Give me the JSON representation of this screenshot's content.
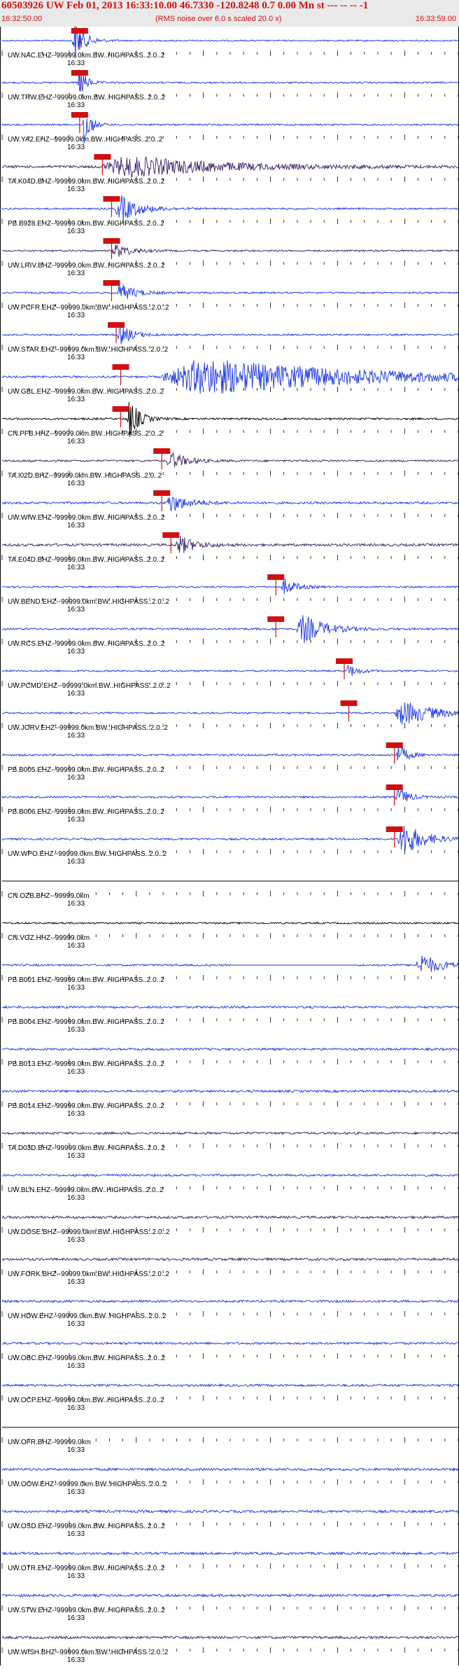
{
  "header": {
    "title": "60503926 UW Feb 01, 2013 16:33:10.00   46.7330 -120.8248  0.7 0.00 Mn st --- -- --  -1",
    "start_time": "16:32:50.00",
    "note": "(RMS noise over 6.0 s scaled 20.0 x)",
    "end_time": "16:33:59.00"
  },
  "colors": {
    "accent": "#d01010",
    "trace_blue": "#1a35e8",
    "trace_black": "#000000",
    "trace_purple": "#3a1e6a"
  },
  "time_tick_label": "16:33",
  "traces": [
    {
      "label": "UW.NAC.EHZ--99999.0km.BW..HIGHPASS..2.0..2",
      "color": "blue",
      "pick": 0.17,
      "event": [
        0.16,
        0.03,
        1.8
      ],
      "noise": 0.25
    },
    {
      "label": "UW.TRW.EHZ--99999.0km.BW..HIGHPASS..2.0..2",
      "color": "blue",
      "pick": 0.17,
      "event": [
        0.17,
        0.02,
        1.5
      ],
      "noise": 0.3
    },
    {
      "label": "UW.YA2.EHZ--99999.0km.BW..HIGHPASS..2.0..2",
      "color": "blue",
      "pick": 0.17,
      "event": [
        0.18,
        0.02,
        2.0
      ],
      "noise": 0.3
    },
    {
      "label": "TA.K04D.BHZ--99999.0km.BW..HIGHPASS..2.0..2",
      "color": "purple",
      "pick": 0.22,
      "event": [
        0.28,
        0.3,
        0.9
      ],
      "noise": 0.45
    },
    {
      "label": "PB.B928.EHZ--99999.0km.BW..HIGHPASS..2.0..2",
      "color": "blue",
      "pick": 0.24,
      "event": [
        0.26,
        0.06,
        1.2
      ],
      "noise": 0.3
    },
    {
      "label": "UW.LRIV.BHZ--99999.0km.BW..HIGHPASS..2.0..2",
      "color": "purple",
      "pick": 0.24,
      "event": [
        0.25,
        0.05,
        0.6
      ],
      "noise": 0.3
    },
    {
      "label": "UW.PCFR.EHZ--99999.0km.BW..HIGHPASS..2.0..2",
      "color": "blue",
      "pick": 0.24,
      "event": [
        0.26,
        0.05,
        0.8
      ],
      "noise": 0.3
    },
    {
      "label": "UW.STAR.EHZ--99999.0km.BW..HIGHPASS..2.0..2",
      "color": "blue",
      "pick": 0.25,
      "event": [
        0.26,
        0.04,
        0.9
      ],
      "noise": 0.3
    },
    {
      "label": "UW.GBL.EHZ--99999.0km.BW..HIGHPASS..2.0..2",
      "color": "blue",
      "pick": 0.26,
      "event": [
        0.45,
        0.5,
        1.6
      ],
      "noise": 0.35
    },
    {
      "label": "CN.PFB.HHZ--99999.0km.BW..HIGHPASS..2.0..2",
      "color": "black",
      "pick": 0.26,
      "event": [
        0.28,
        0.03,
        1.8
      ],
      "noise": 0.35
    },
    {
      "label": "TA.I02D.BHZ--99999.0km.BW..HIGHPASS..2.0..2",
      "color": "purple",
      "pick": 0.35,
      "event": [
        0.37,
        0.05,
        0.8
      ],
      "noise": 0.35
    },
    {
      "label": "UW.WIW.EHZ--99999.0km.BW..HIGHPASS..2.0..2",
      "color": "blue",
      "pick": 0.35,
      "event": [
        0.37,
        0.06,
        0.8
      ],
      "noise": 0.4
    },
    {
      "label": "TA.E04D.BHZ--99999.0km.BW..HIGHPASS..2.0..2",
      "color": "purple",
      "pick": 0.37,
      "event": [
        0.39,
        0.05,
        0.8
      ],
      "noise": 0.45
    },
    {
      "label": "UW.BEND.EHZ--99999.0km.BW..HIGHPASS..2.0..2",
      "color": "blue",
      "pick": 0.6,
      "event": [
        0.62,
        0.04,
        0.7
      ],
      "noise": 0.3
    },
    {
      "label": "UW.RCS.EHZ--99999.0km.BW..HIGHPASS..2.0..2",
      "color": "blue",
      "pick": 0.6,
      "event": [
        0.66,
        0.07,
        1.3
      ],
      "noise": 0.35
    },
    {
      "label": "UW.PCMD.EHZ--99999.0km.BW..HIGHPASS..2.0..2",
      "color": "blue",
      "pick": 0.75,
      "event": [
        0.76,
        0.03,
        0.6
      ],
      "noise": 0.3
    },
    {
      "label": "UW.JORV.EHZ--99999.0km.BW..HIGHPASS..2.0..2",
      "color": "blue",
      "pick": 0.76,
      "event": [
        0.88,
        0.1,
        1.1
      ],
      "noise": 0.3
    },
    {
      "label": "PB.B005.EHZ--99999.0km.BW..HIGHPASS..2.0..2",
      "color": "blue",
      "pick": 0.86,
      "event": [
        0.87,
        0.03,
        0.9
      ],
      "noise": 0.35
    },
    {
      "label": "PB.B006.EHZ--99999.0km.BW..HIGHPASS..2.0..2",
      "color": "blue",
      "pick": 0.86,
      "event": [
        0.87,
        0.03,
        0.9
      ],
      "noise": 0.35
    },
    {
      "label": "UW.WPO.EHZ--99999.0km.BW..HIGHPASS..2.0..2",
      "color": "blue",
      "pick": 0.86,
      "event": [
        0.88,
        0.06,
        1.6
      ],
      "noise": 0.35
    },
    {
      "label": "CN.OZB.BHZ--99999.0km",
      "color": "black",
      "pick": null,
      "event": null,
      "noise": 0.0
    },
    {
      "label": "CN.VGZ.HHZ--99999.0km",
      "color": "black",
      "pick": null,
      "event": null,
      "noise": 0.3
    },
    {
      "label": "PB.B001.EHZ--99999.0km.BW..HIGHPASS..2.0..2",
      "color": "blue",
      "pick": null,
      "event": [
        0.92,
        0.06,
        1.0
      ],
      "noise": 0.35,
      "gap": [
        0.5,
        0.78
      ]
    },
    {
      "label": "PB.B004.EHZ--99999.0km.BW..HIGHPASS..2.0..2",
      "color": "blue",
      "pick": null,
      "event": null,
      "noise": 0.4
    },
    {
      "label": "PB.B013.EHZ--99999.0km.BW..HIGHPASS..2.0..2",
      "color": "blue",
      "pick": null,
      "event": null,
      "noise": 0.4
    },
    {
      "label": "PB.B014.EHZ--99999.0km.BW..HIGHPASS..2.0..2",
      "color": "blue",
      "pick": null,
      "event": null,
      "noise": 0.4
    },
    {
      "label": "TA.D03D.BHZ--99999.0km.BW..HIGHPASS..2.0..2",
      "color": "purple",
      "pick": null,
      "event": null,
      "noise": 0.4
    },
    {
      "label": "UW.BLN.EHZ--99999.0km.BW..HIGHPASS..2.0..2",
      "color": "blue",
      "pick": null,
      "event": null,
      "noise": 0.4
    },
    {
      "label": "UW.DOSE.BHZ--99999.0km.BW..HIGHPASS..2.0..2",
      "color": "purple",
      "pick": null,
      "event": null,
      "noise": 0.45
    },
    {
      "label": "UW.FORK.BHZ--99999.0km.BW..HIGHPASS..2.0..2",
      "color": "purple",
      "pick": null,
      "event": null,
      "noise": 0.45
    },
    {
      "label": "UW.HDW.EHZ--99999.0km.BW..HIGHPASS..2.0..2",
      "color": "blue",
      "pick": null,
      "event": null,
      "noise": 0.4
    },
    {
      "label": "UW.OBC.EHZ--99999.0km.BW..HIGHPASS..2.0..2",
      "color": "blue",
      "pick": null,
      "event": null,
      "noise": 0.4
    },
    {
      "label": "UW.OCP.EHZ--99999.0km.BW..HIGHPASS..2.0..2",
      "color": "blue",
      "pick": null,
      "event": null,
      "noise": 0.4
    },
    {
      "label": "UW.OFR.BHZ--99999.0km",
      "color": "black",
      "pick": null,
      "event": null,
      "noise": 0.0
    },
    {
      "label": "UW.OOW.EHZ--99999.0km.BW..HIGHPASS..2.0..2",
      "color": "blue",
      "pick": null,
      "event": null,
      "noise": 0.45
    },
    {
      "label": "UW.OSD.EHZ--99999.0km.BW..HIGHPASS..2.0..2",
      "color": "blue",
      "pick": null,
      "event": null,
      "noise": 0.45
    },
    {
      "label": "UW.OTR.EHZ--99999.0km.BW..HIGHPASS..2.0..2",
      "color": "blue",
      "pick": null,
      "event": null,
      "noise": 0.45
    },
    {
      "label": "UW.STW.EHZ--99999.0km.BW..HIGHPASS..2.0..2",
      "color": "blue",
      "pick": null,
      "event": null,
      "noise": 0.45
    },
    {
      "label": "UW.WISH.BHZ--99999.0km.BW..HIGHPASS..2.0..2",
      "color": "purple",
      "pick": null,
      "event": null,
      "noise": 0.45
    }
  ]
}
